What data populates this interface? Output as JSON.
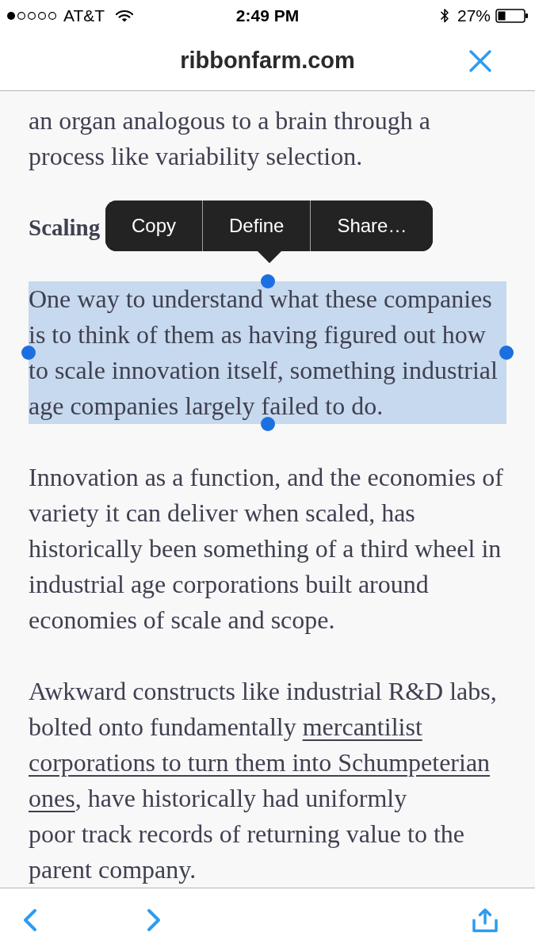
{
  "status_bar": {
    "carrier": "AT&T",
    "time": "2:49 PM",
    "battery": "27%"
  },
  "header": {
    "title": "ribbonfarm.com"
  },
  "article": {
    "blocks": [
      {
        "kind": "paragraph",
        "selected": false,
        "lines": [
          [
            {
              "kind": "text",
              "text": "an organ analogous to a brain through a"
            }
          ],
          [
            {
              "kind": "text",
              "text": "process like variability selection."
            }
          ]
        ]
      },
      {
        "kind": "heading",
        "selected": false,
        "lines": [
          [
            {
              "kind": "text",
              "text": "Scaling"
            }
          ]
        ]
      },
      {
        "kind": "paragraph",
        "selected": true,
        "lines": [
          [
            {
              "kind": "text",
              "text": "One way to understand what these companies"
            }
          ],
          [
            {
              "kind": "text",
              "text": "is to think of them as having figured out how"
            }
          ],
          [
            {
              "kind": "text",
              "text": "to scale innovation itself, something industrial"
            }
          ],
          [
            {
              "kind": "text",
              "text": "age companies largely failed to do."
            }
          ]
        ]
      },
      {
        "kind": "paragraph",
        "selected": false,
        "lines": [
          [
            {
              "kind": "text",
              "text": "Innovation as a function, and the economies of"
            }
          ],
          [
            {
              "kind": "text",
              "text": "variety it can deliver when scaled, has"
            }
          ],
          [
            {
              "kind": "text",
              "text": "historically been something of a third wheel in"
            }
          ],
          [
            {
              "kind": "text",
              "text": "industrial age corporations built around"
            }
          ],
          [
            {
              "kind": "text",
              "text": "economies of scale and scope."
            }
          ]
        ]
      },
      {
        "kind": "paragraph",
        "selected": false,
        "lines": [
          [
            {
              "kind": "text",
              "text": "Awkward constructs like industrial R&D labs,"
            }
          ],
          [
            {
              "kind": "text",
              "text": "bolted onto fundamentally "
            },
            {
              "kind": "link",
              "text": "mercantilist"
            }
          ],
          [
            {
              "kind": "link",
              "text": "corporations to turn them into Schumpeterian"
            }
          ],
          [
            {
              "kind": "link",
              "text": "ones"
            },
            {
              "kind": "text",
              "text": ", have historically had uniformly"
            }
          ],
          [
            {
              "kind": "text",
              "text": "poor track records of returning value to the"
            }
          ],
          [
            {
              "kind": "text",
              "text": "parent company."
            }
          ]
        ]
      }
    ]
  },
  "context_menu": {
    "items": [
      {
        "label": "Copy"
      },
      {
        "label": "Define"
      },
      {
        "label": "Share…"
      }
    ]
  }
}
